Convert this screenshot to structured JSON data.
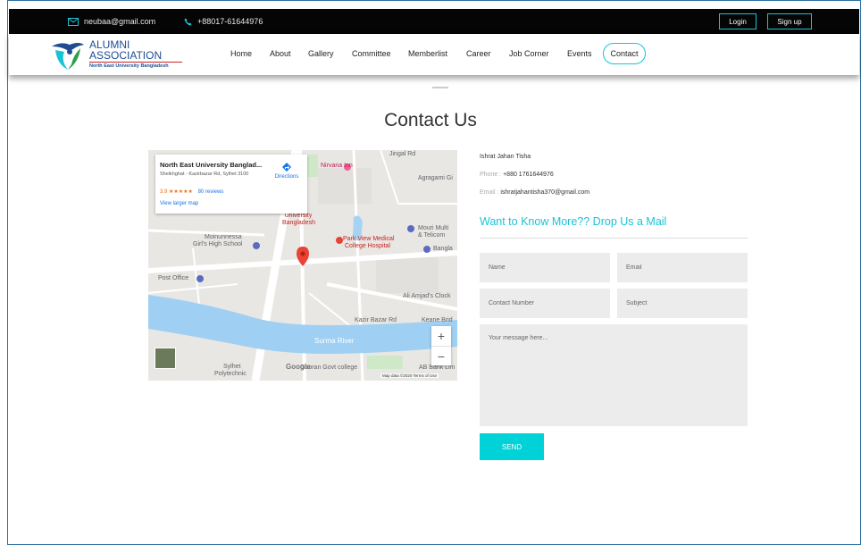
{
  "topbar": {
    "email": "neubaa@gmail.com",
    "phone": "+88017-61644976",
    "login_label": "Login",
    "signup_label": "Sign up"
  },
  "logo": {
    "line1": "ALUMNI",
    "line2": "ASSOCIATION",
    "line3": "North East University Bangladesh"
  },
  "nav": {
    "items": [
      "Home",
      "About",
      "Gallery",
      "Committee",
      "Memberlist",
      "Career",
      "Job Corner",
      "Events"
    ],
    "active_label": "Contact"
  },
  "page_title": "Contact Us",
  "map": {
    "place_name": "North East University Banglad...",
    "address": "Sheikhghat - Kazirbazar Rd, Sylhet 3100",
    "rating": "3.9",
    "stars": "★★★★★",
    "reviews": "80 reviews",
    "directions": "Directions",
    "larger_map": "View larger map",
    "labels": {
      "nirvana": "Nirvana Inn",
      "agragami": "Agragami Gi",
      "mouri": "Mouri Multi",
      "mouri2": "& Telicom",
      "neu": "ast University Bangladesh",
      "moinunnessa": "Moinunnessa",
      "girls_school": "Girl's High School",
      "parkview": "Park View Medical",
      "parkview2": "College Hospital",
      "bangla": "Bangla",
      "post_office": "Post Office",
      "ali": "Ali Amjad's Clock",
      "kazir": "Kazir Bazar Rd",
      "keane": "Keane Brid",
      "surma": "Surma River",
      "sylhet": "Sylhet",
      "polytechnic": "Polytechnic",
      "govt_college": "Gooran Govt college",
      "ab_bank": "AB Bank Lim",
      "jingal": "Jingal Rd",
      "google": "Google",
      "footer": "Map data ©2020   Terms of Use"
    },
    "zoom_in": "+",
    "zoom_out": "−"
  },
  "contact": {
    "name": "Ishrat Jahan Tisha",
    "phone_label": "Phone :",
    "phone": "+880 1761644976",
    "email_label": "Email :",
    "email": "ishratjahantisha370@gmail.com"
  },
  "form": {
    "heading": "Want to Know More?? Drop Us a Mail",
    "name_placeholder": "Name",
    "email_placeholder": "Email",
    "contact_placeholder": "Contact Number",
    "subject_placeholder": "Subject",
    "message_placeholder": "Your message here...",
    "send_label": "SEND"
  },
  "colors": {
    "accent": "#19c3d6",
    "send_button": "#00d2d8",
    "topbar": "#050505"
  }
}
